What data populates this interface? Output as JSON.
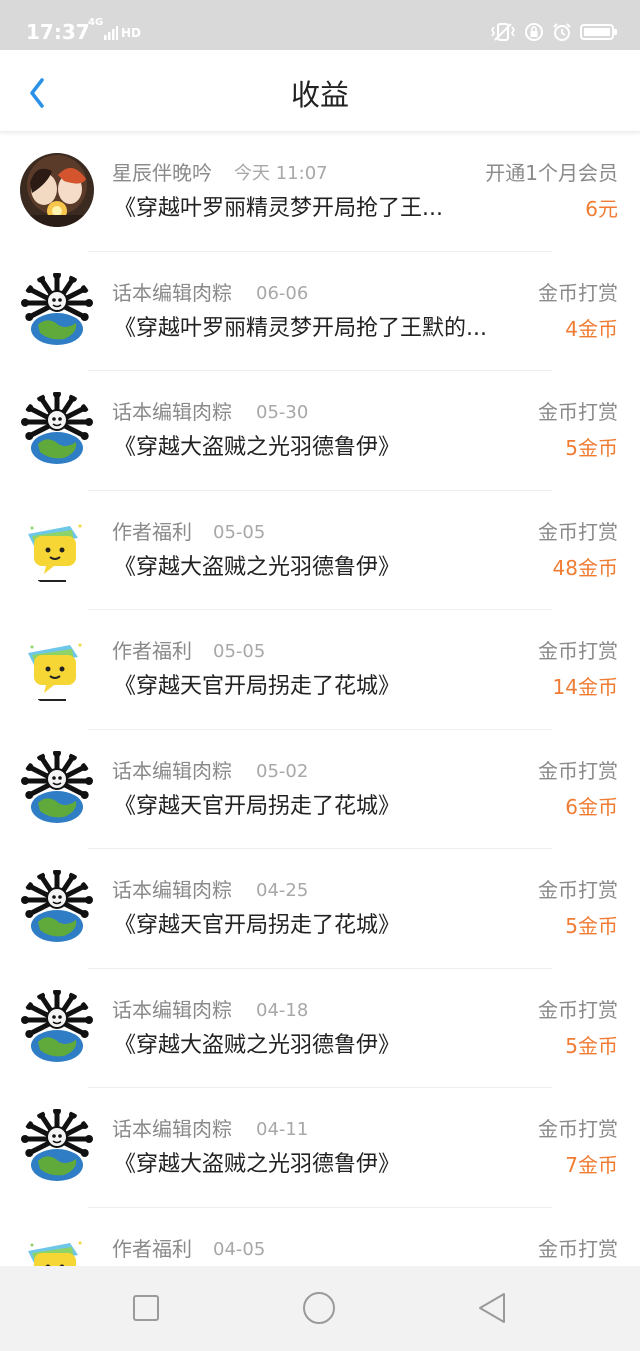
{
  "status_bar": {
    "time": "17:37",
    "network": "4G",
    "hd": "HD"
  },
  "header": {
    "title": "收益"
  },
  "records": [
    {
      "name": "星辰伴晚吟",
      "date": "今天 11:07",
      "type": "开通1个月会员",
      "title": "《穿越叶罗丽精灵梦开局抢了王...",
      "amount": "6元",
      "avatar": "anime-avatar"
    },
    {
      "name": "话本编辑肉粽",
      "date": "06-06",
      "type": "金币打赏",
      "title": "《穿越叶罗丽精灵梦开局抢了王默的...",
      "amount": "4金币",
      "avatar": "earth-bones-avatar"
    },
    {
      "name": "话本编辑肉粽",
      "date": "05-30",
      "type": "金币打赏",
      "title": "《穿越大盗贼之光羽德鲁伊》",
      "amount": "5金币",
      "avatar": "earth-bones-avatar"
    },
    {
      "name": "作者福利",
      "date": "05-05",
      "type": "金币打赏",
      "title": "《穿越大盗贼之光羽德鲁伊》",
      "amount": "48金币",
      "avatar": "chat-bubble-avatar"
    },
    {
      "name": "作者福利",
      "date": "05-05",
      "type": "金币打赏",
      "title": "《穿越天官开局拐走了花城》",
      "amount": "14金币",
      "avatar": "chat-bubble-avatar"
    },
    {
      "name": "话本编辑肉粽",
      "date": "05-02",
      "type": "金币打赏",
      "title": "《穿越天官开局拐走了花城》",
      "amount": "6金币",
      "avatar": "earth-bones-avatar"
    },
    {
      "name": "话本编辑肉粽",
      "date": "04-25",
      "type": "金币打赏",
      "title": "《穿越天官开局拐走了花城》",
      "amount": "5金币",
      "avatar": "earth-bones-avatar"
    },
    {
      "name": "话本编辑肉粽",
      "date": "04-18",
      "type": "金币打赏",
      "title": "《穿越大盗贼之光羽德鲁伊》",
      "amount": "5金币",
      "avatar": "earth-bones-avatar"
    },
    {
      "name": "话本编辑肉粽",
      "date": "04-11",
      "type": "金币打赏",
      "title": "《穿越大盗贼之光羽德鲁伊》",
      "amount": "7金币",
      "avatar": "earth-bones-avatar"
    },
    {
      "name": "作者福利",
      "date": "04-05",
      "type": "金币打赏",
      "title": "",
      "amount": "",
      "avatar": "chat-bubble-avatar"
    }
  ],
  "colors": {
    "accent": "#2a90e8",
    "amount": "#f07c33",
    "status_bar": "#d9d9d9"
  },
  "bottom_nav": {
    "icons": [
      "square-icon",
      "circle-icon",
      "triangle-back-icon"
    ]
  }
}
